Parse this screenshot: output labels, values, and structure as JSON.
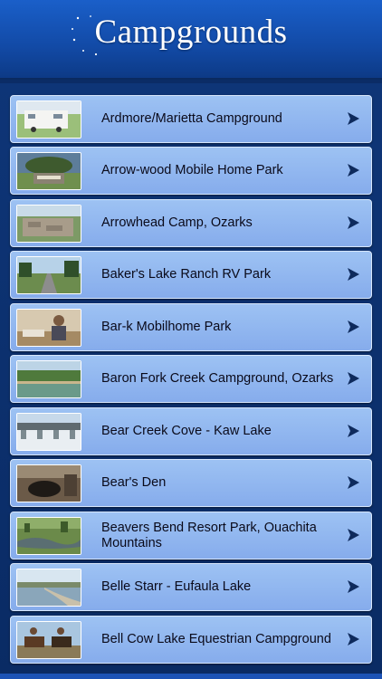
{
  "header": {
    "title": "Campgrounds"
  },
  "list": {
    "items": [
      {
        "label": "Ardmore/Marietta Campground",
        "thumb": "rv-camper-photo"
      },
      {
        "label": "Arrow-wood Mobile Home Park",
        "thumb": "park-sign-photo"
      },
      {
        "label": "Arrowhead Camp, Ozarks",
        "thumb": "stone-wall-photo"
      },
      {
        "label": "Baker's Lake Ranch RV Park",
        "thumb": "road-trees-photo"
      },
      {
        "label": "Bar-k Mobilhome Park",
        "thumb": "people-photo"
      },
      {
        "label": "Baron Fork Creek Campground, Ozarks",
        "thumb": "creek-photo"
      },
      {
        "label": "Bear Creek Cove - Kaw Lake",
        "thumb": "dam-photo"
      },
      {
        "label": "Bear's Den",
        "thumb": "cave-photo"
      },
      {
        "label": "Beavers Bend Resort Park, Ouachita Mountains",
        "thumb": "forest-creek-photo"
      },
      {
        "label": "Belle Starr - Eufaula Lake",
        "thumb": "lake-photo"
      },
      {
        "label": "Bell Cow Lake Equestrian Campground",
        "thumb": "horse-riders-photo"
      }
    ],
    "arrow_icon": "chevron-right-icon"
  },
  "colors": {
    "header_bg": "#124aa6",
    "list_bg": "#0b2c66",
    "row_bg": "#94b9f0",
    "arrow": "#0e2a5c"
  }
}
